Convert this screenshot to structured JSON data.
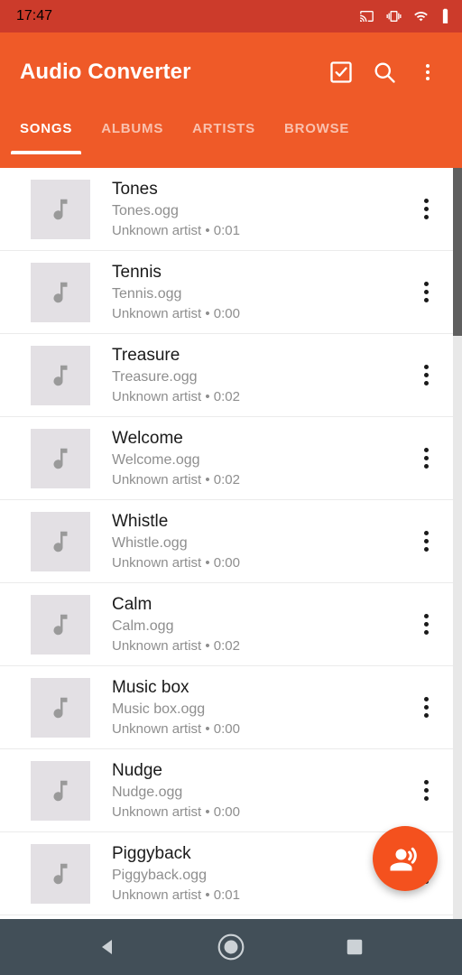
{
  "status_bar": {
    "clock": "17:47",
    "icons": [
      "cast-icon",
      "vibrate-icon",
      "wifi-icon",
      "battery-icon"
    ],
    "background_color": "#CC3B2B"
  },
  "app_bar": {
    "title": "Audio Converter",
    "background_color": "#EF5A28",
    "actions": [
      {
        "name": "select-all-button",
        "icon": "checkbox-checked-icon"
      },
      {
        "name": "search-button",
        "icon": "search-icon"
      },
      {
        "name": "overflow-menu-button",
        "icon": "more-vertical-icon"
      }
    ]
  },
  "tabs": {
    "active_index": 0,
    "items": [
      {
        "label": "SONGS"
      },
      {
        "label": "ALBUMS"
      },
      {
        "label": "ARTISTS"
      },
      {
        "label": "BROWSE"
      }
    ]
  },
  "songs": [
    {
      "title": "Tones",
      "file": "Tones.ogg",
      "meta": "Unknown artist • 0:01"
    },
    {
      "title": "Tennis",
      "file": "Tennis.ogg",
      "meta": "Unknown artist • 0:00"
    },
    {
      "title": "Treasure",
      "file": "Treasure.ogg",
      "meta": "Unknown artist • 0:02"
    },
    {
      "title": "Welcome",
      "file": "Welcome.ogg",
      "meta": "Unknown artist • 0:02"
    },
    {
      "title": "Whistle",
      "file": "Whistle.ogg",
      "meta": "Unknown artist • 0:00"
    },
    {
      "title": "Calm",
      "file": "Calm.ogg",
      "meta": "Unknown artist • 0:02"
    },
    {
      "title": "Music box",
      "file": "Music box.ogg",
      "meta": "Unknown artist • 0:00"
    },
    {
      "title": "Nudge",
      "file": "Nudge.ogg",
      "meta": "Unknown artist • 0:00"
    },
    {
      "title": "Piggyback",
      "file": "Piggyback.ogg",
      "meta": "Unknown artist • 0:01"
    }
  ],
  "fab": {
    "icon": "record-voice-over-icon",
    "color": "#F4511E"
  },
  "nav_bar": {
    "background_color": "#424F58",
    "buttons": [
      {
        "name": "nav-back-button",
        "icon": "back-triangle-icon"
      },
      {
        "name": "nav-home-button",
        "icon": "home-circle-icon"
      },
      {
        "name": "nav-recents-button",
        "icon": "recents-square-icon"
      }
    ]
  }
}
